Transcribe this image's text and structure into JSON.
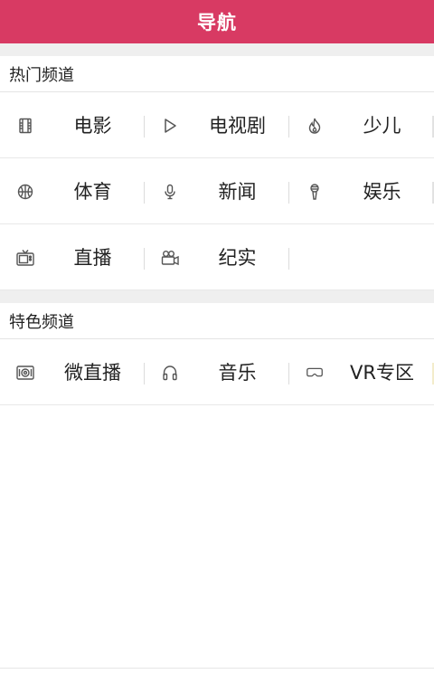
{
  "header": {
    "title": "导航"
  },
  "sections": [
    {
      "title": "热门频道",
      "rows": [
        [
          {
            "label": "电影",
            "icon": "film-icon"
          },
          {
            "label": "电视剧",
            "icon": "play-icon"
          },
          {
            "label": "少儿",
            "icon": "flame-icon"
          }
        ],
        [
          {
            "label": "体育",
            "icon": "basketball-icon"
          },
          {
            "label": "新闻",
            "icon": "microphone-icon"
          },
          {
            "label": "娱乐",
            "icon": "karaoke-mic-icon"
          }
        ],
        [
          {
            "label": "直播",
            "icon": "tv-icon"
          },
          {
            "label": "纪实",
            "icon": "camera-icon"
          }
        ]
      ]
    },
    {
      "title": "特色频道",
      "rows": [
        [
          {
            "label": "微直播",
            "icon": "speaker-icon"
          },
          {
            "label": "音乐",
            "icon": "headphones-icon"
          },
          {
            "label": "VR专区",
            "icon": "vr-goggles-icon"
          }
        ]
      ]
    }
  ],
  "colors": {
    "header_bg": "#d83a63",
    "section_gap": "#efefef"
  }
}
